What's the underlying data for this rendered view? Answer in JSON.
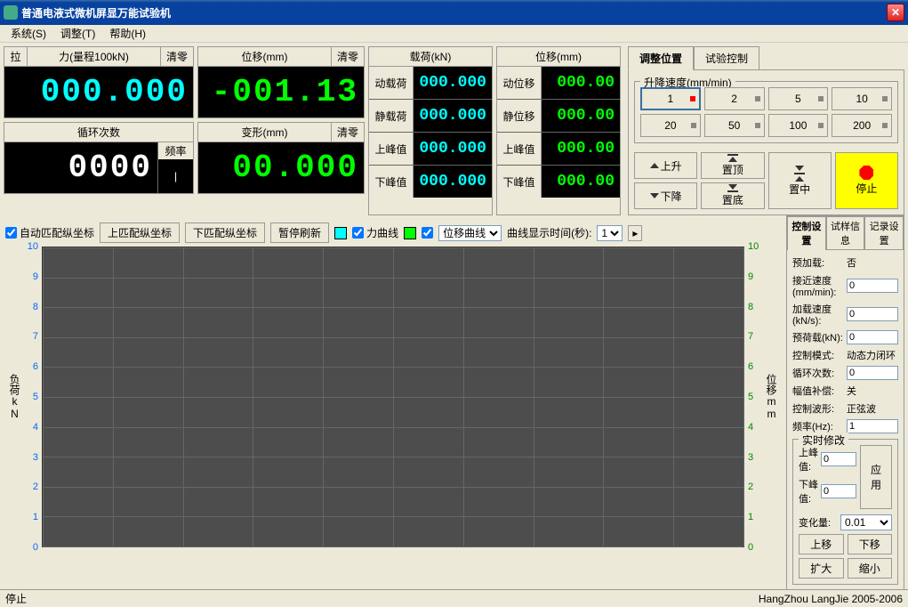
{
  "window": {
    "title": "普通电液式微机屏显万能试验机"
  },
  "menu": {
    "system": "系统(S)",
    "adjust": "调整(T)",
    "help": "帮助(H)"
  },
  "display": {
    "force": {
      "pull": "拉",
      "label": "力(量程100kN)",
      "zero": "清零",
      "value": "000.000"
    },
    "disp": {
      "label": "位移(mm)",
      "zero": "清零",
      "value": "-001.13"
    },
    "cycles": {
      "label": "循环次数",
      "freq": "频率",
      "value": "0000"
    },
    "deform": {
      "label": "变形(mm)",
      "zero": "清零",
      "value": "00.000"
    }
  },
  "load_panel": {
    "title": "载荷(kN)",
    "rows": [
      {
        "label": "动载荷",
        "value": "000.000"
      },
      {
        "label": "静载荷",
        "value": "000.000"
      },
      {
        "label": "上峰值",
        "value": "000.000"
      },
      {
        "label": "下峰值",
        "value": "000.000"
      }
    ]
  },
  "disp_panel": {
    "title": "位移(mm)",
    "rows": [
      {
        "label": "动位移",
        "value": "000.00"
      },
      {
        "label": "静位移",
        "value": "000.00"
      },
      {
        "label": "上峰值",
        "value": "000.00"
      },
      {
        "label": "下峰值",
        "value": "000.00"
      }
    ]
  },
  "right_tabs": {
    "pos": "调整位置",
    "test": "试验控制"
  },
  "speed": {
    "title": "升降速度(mm/min)",
    "options": [
      "1",
      "2",
      "5",
      "10",
      "20",
      "50",
      "100",
      "200"
    ]
  },
  "move": {
    "up": "上升",
    "top": "置顶",
    "center": "置中",
    "down": "下降",
    "bottom": "置底",
    "stop": "停止"
  },
  "chart_toolbar": {
    "auto_y": "自动匹配纵坐标",
    "fit_up": "上匹配纵坐标",
    "fit_down": "下匹配纵坐标",
    "pause": "暂停刷新",
    "force_curve": "力曲线",
    "disp_curve": "位移曲线",
    "display_time": "曲线显示时间(秒):",
    "time_value": "1"
  },
  "chart_data": {
    "type": "line",
    "title": "",
    "left_axis": {
      "label": "负荷",
      "unit": "kN",
      "ticks": [
        0,
        1,
        2,
        3,
        4,
        5,
        6,
        7,
        8,
        9,
        10
      ],
      "color": "#0066ff"
    },
    "right_axis": {
      "label": "位移",
      "unit": "mm",
      "ticks": [
        0,
        1,
        2,
        3,
        4,
        5,
        6,
        7,
        8,
        9,
        10
      ],
      "color": "#008800"
    },
    "series": [
      {
        "name": "力曲线",
        "color": "#00ffff",
        "values": []
      },
      {
        "name": "位移曲线",
        "color": "#00ff00",
        "values": []
      }
    ]
  },
  "settings_tabs": {
    "ctrl": "控制设置",
    "sample": "试样信息",
    "record": "记录设置"
  },
  "settings": {
    "preload": {
      "label": "预加载:",
      "value": "否"
    },
    "approach": {
      "label": "接近速度(mm/min):",
      "value": "0"
    },
    "loadspeed": {
      "label": "加载速度(kN/s):",
      "value": "0"
    },
    "preloadval": {
      "label": "预荷载(kN):",
      "value": "0"
    },
    "mode": {
      "label": "控制模式:",
      "value": "动态力闭环"
    },
    "cycles": {
      "label": "循环次数:",
      "value": "0"
    },
    "amp": {
      "label": "幅值补偿:",
      "value": "关"
    },
    "wave": {
      "label": "控制波形:",
      "value": "正弦波"
    },
    "freq": {
      "label": "频率(Hz):",
      "value": "1"
    }
  },
  "realtime": {
    "title": "实时修改",
    "upper": "上峰值:",
    "upper_val": "0",
    "lower": "下峰值:",
    "lower_val": "0",
    "apply": "应用",
    "delta": "变化量:",
    "delta_val": "0.01",
    "move_up": "上移",
    "move_down": "下移",
    "zoom_in": "扩大",
    "zoom_out": "缩小"
  },
  "status": {
    "text": "停止",
    "copyright": "HangZhou LangJie 2005-2006"
  }
}
